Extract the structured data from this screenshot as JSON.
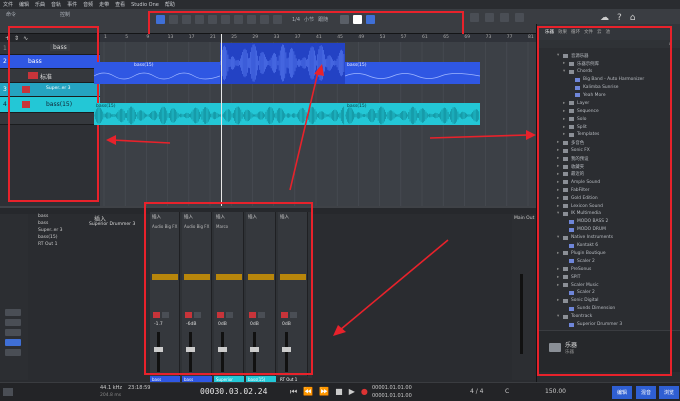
{
  "menubar": {
    "items": [
      "文件",
      "编辑",
      "乐曲",
      "音轨",
      "事件",
      "音频",
      "走带",
      "查看",
      "Studio One",
      "帮助"
    ]
  },
  "toolbar": {
    "left_labels": [
      "命令",
      "控制"
    ],
    "timebase_label": "1/4",
    "mode_label": "小节",
    "sync_label": "跟随"
  },
  "tracks": [
    {
      "num": "1",
      "name": "bass",
      "type": "folder"
    },
    {
      "num": "2",
      "name": "bass",
      "type": "audio",
      "plugin": "标准"
    },
    {
      "num": "3",
      "name": "Super..er 3",
      "type": "instrument",
      "plugin": "Superior Drummer 3"
    },
    {
      "num": "4",
      "name": "bass(15)",
      "type": "audio"
    }
  ],
  "clips": [
    {
      "name": "bass(15)",
      "color": "#2f57e3"
    },
    {
      "name": "bass(15)",
      "color": "#2f57e3"
    },
    {
      "name": "bass(15)",
      "color": "#23c7d6"
    },
    {
      "name": "bass(15)",
      "color": "#23c7d6"
    }
  ],
  "ruler": {
    "marks": [
      "1",
      "5",
      "9",
      "13",
      "17",
      "21",
      "25",
      "29",
      "33",
      "37",
      "41",
      "45",
      "49",
      "53",
      "57",
      "61",
      "65",
      "69",
      "73",
      "77",
      "81"
    ]
  },
  "browser": {
    "tabs": [
      "乐器",
      "效果",
      "循环",
      "文件",
      "云",
      "池"
    ],
    "items": [
      {
        "label": "音源乐器",
        "depth": 0,
        "arrow": "▾"
      },
      {
        "label": "乐器示例库",
        "depth": 1,
        "arrow": "▸"
      },
      {
        "label": "Chords",
        "depth": 1,
        "arrow": "▾"
      },
      {
        "label": "Big Band - Auto Harmonizer",
        "depth": 2,
        "arrow": ""
      },
      {
        "label": "Kalimba Sunrise",
        "depth": 2,
        "arrow": ""
      },
      {
        "label": "Yeah More",
        "depth": 2,
        "arrow": ""
      },
      {
        "label": "Layer",
        "depth": 1,
        "arrow": "▸"
      },
      {
        "label": "Sequence",
        "depth": 1,
        "arrow": "▸"
      },
      {
        "label": "Solo",
        "depth": 1,
        "arrow": "▸"
      },
      {
        "label": "Split",
        "depth": 1,
        "arrow": "▸"
      },
      {
        "label": "Templates",
        "depth": 1,
        "arrow": "▸"
      },
      {
        "label": "多音色",
        "depth": 0,
        "arrow": "▸"
      },
      {
        "label": "Sonic FX",
        "depth": 0,
        "arrow": "▸"
      },
      {
        "label": "我的预设",
        "depth": 0,
        "arrow": "▸"
      },
      {
        "label": "收藏夹",
        "depth": 0,
        "arrow": "▸"
      },
      {
        "label": "最近的",
        "depth": 0,
        "arrow": "▸"
      },
      {
        "label": "Ample Sound",
        "depth": 0,
        "arrow": "▸"
      },
      {
        "label": "FabFilter",
        "depth": 0,
        "arrow": "▸"
      },
      {
        "label": "Gold Edition",
        "depth": 0,
        "arrow": "▸"
      },
      {
        "label": "Lexicon Sound",
        "depth": 0,
        "arrow": "▸"
      },
      {
        "label": "IK Multimedia",
        "depth": 0,
        "arrow": "▾"
      },
      {
        "label": "MODO BASS 2",
        "depth": 1,
        "arrow": ""
      },
      {
        "label": "MODO DRUM",
        "depth": 1,
        "arrow": ""
      },
      {
        "label": "Native Instruments",
        "depth": 0,
        "arrow": "▾"
      },
      {
        "label": "Kontakt 6",
        "depth": 1,
        "arrow": ""
      },
      {
        "label": "Plugin Boutique",
        "depth": 0,
        "arrow": "▸"
      },
      {
        "label": "Scaler 2",
        "depth": 1,
        "arrow": ""
      },
      {
        "label": "PreSonus",
        "depth": 0,
        "arrow": "▸"
      },
      {
        "label": "SPIT",
        "depth": 0,
        "arrow": "▸"
      },
      {
        "label": "Scaler Music",
        "depth": 0,
        "arrow": "▸"
      },
      {
        "label": "Scaler 2",
        "depth": 1,
        "arrow": ""
      },
      {
        "label": "Sonic Digital",
        "depth": 0,
        "arrow": "▸"
      },
      {
        "label": "Sunds Dimension",
        "depth": 1,
        "arrow": ""
      },
      {
        "label": "Toontrack",
        "depth": 0,
        "arrow": "▾"
      },
      {
        "label": "Superior Drummer 3",
        "depth": 1,
        "arrow": ""
      }
    ],
    "footer_label": "乐器",
    "footer_sub": "乐器"
  },
  "console": {
    "left_list": [
      "bass",
      "bass",
      "Super..er 3",
      "bass(15)",
      "RT Out 1"
    ],
    "inserts_head": "插入",
    "instrument_entry": "Superior Drummer 3",
    "strips": [
      {
        "name": "bass",
        "color": "#2f57e3",
        "value": "-1.7",
        "insert": "Audio Big FX"
      },
      {
        "name": "bass",
        "color": "#2f57e3",
        "value": "-6dB",
        "insert": "Audio Big FX"
      },
      {
        "name": "Superior Dr..er 3",
        "color": "#23c7d6",
        "value": "0dB",
        "insert": "Marco"
      },
      {
        "name": "bass(15)",
        "color": "#23c7d6",
        "value": "0dB",
        "insert": ""
      },
      {
        "name": "RT Out 1",
        "color": "#2b2d31",
        "value": "0dB",
        "insert": ""
      }
    ],
    "right_panel": [
      "Main Out"
    ]
  },
  "transport": {
    "sample_rate": "44.1 kHz",
    "time_a": "23:18:59",
    "buffer": "204.8 ms",
    "position": "00030.03.02.24",
    "left_loc": "00001.01.01.00",
    "right_loc": "00001.01.01.00",
    "meter": "4 / 4",
    "tempo": "150.00",
    "key": "C",
    "btn_edit": "编辑",
    "btn_mix": "混音",
    "btn_browse": "浏览"
  }
}
